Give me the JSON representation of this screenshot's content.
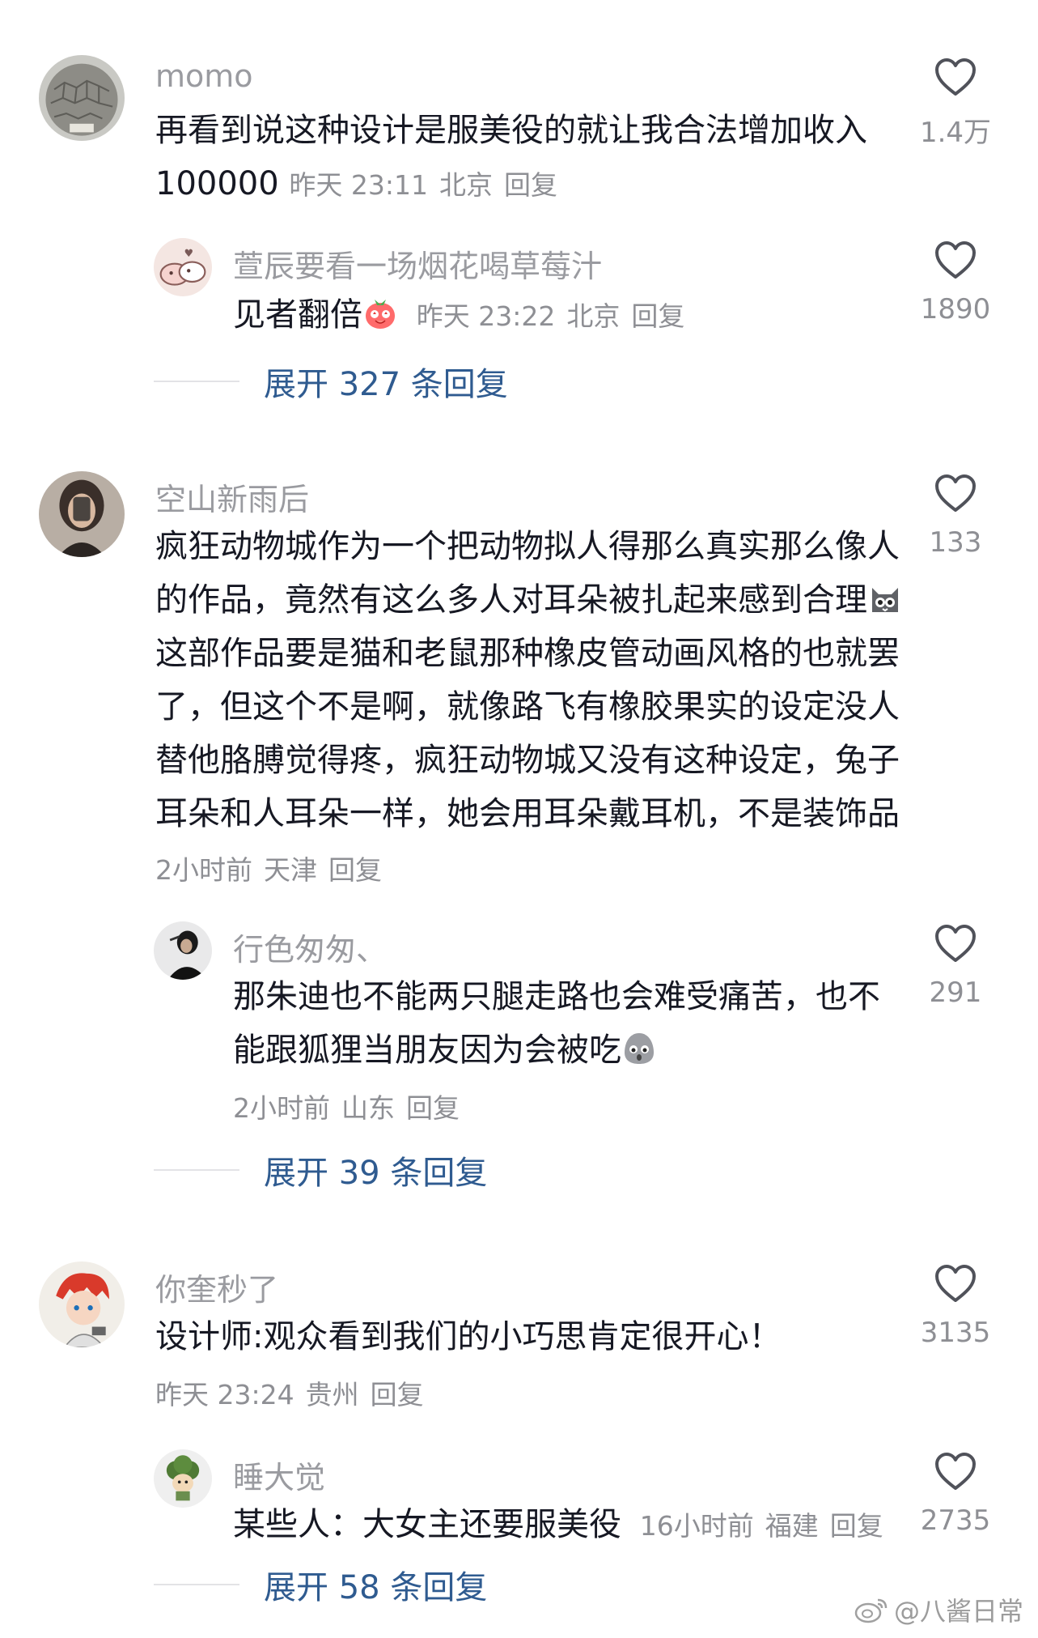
{
  "comments": [
    {
      "author": "momo",
      "text": "再看到说这种设计是服美役的就让我合法增加收入100000",
      "time": "昨天 23:11",
      "location": "北京",
      "reply_label": "回复",
      "likes": "1.4万",
      "replies": [
        {
          "author": "萱辰要看一场烟花喝草莓汁",
          "text": "见者翻倍",
          "emoji": "strawberry-face-emoji",
          "time": "昨天 23:22",
          "location": "北京",
          "reply_label": "回复",
          "likes": "1890"
        }
      ],
      "expand_label": "展开 327 条回复"
    },
    {
      "author": "空山新雨后",
      "text_part1": "疯狂动物城作为一个把动物拟人得那么真实那么像人的作品，竟然有这么多人对耳朵被扎起来感到合理",
      "emoji": "cat-face-emoji",
      "text_part2": "这部作品要是猫和老鼠那种橡皮管动画风格的也就罢了，但这个不是啊，就像路飞有橡胶果实的设定没人替他胳膊觉得疼，疯狂动物城又没有这种设定，兔子耳朵和人耳朵一样，她会用耳朵戴耳机，不是装饰品",
      "time": "2小时前",
      "location": "天津",
      "reply_label": "回复",
      "likes": "133",
      "replies": [
        {
          "author": "行色匆匆、",
          "text": "那朱迪也不能两只腿走路也会难受痛苦，也不能跟狐狸当朋友因为会被吃",
          "emoji": "sad-blob-emoji",
          "time": "2小时前",
          "location": "山东",
          "reply_label": "回复",
          "likes": "291"
        }
      ],
      "expand_label": "展开 39 条回复"
    },
    {
      "author": "你奎秒了",
      "text": "设计师:观众看到我们的小巧思肯定很开心！",
      "time": "昨天 23:24",
      "location": "贵州",
      "reply_label": "回复",
      "likes": "3135",
      "replies": [
        {
          "author": "睡大觉",
          "text": "某些人：大女主还要服美役",
          "time": "16小时前",
          "location": "福建",
          "reply_label": "回复",
          "likes": "2735"
        }
      ],
      "expand_label": "展开 58 条回复"
    }
  ],
  "watermark": "@八酱日常",
  "icons": {
    "like": "heart-outline-icon",
    "watermark": "weibo-logo-icon"
  }
}
